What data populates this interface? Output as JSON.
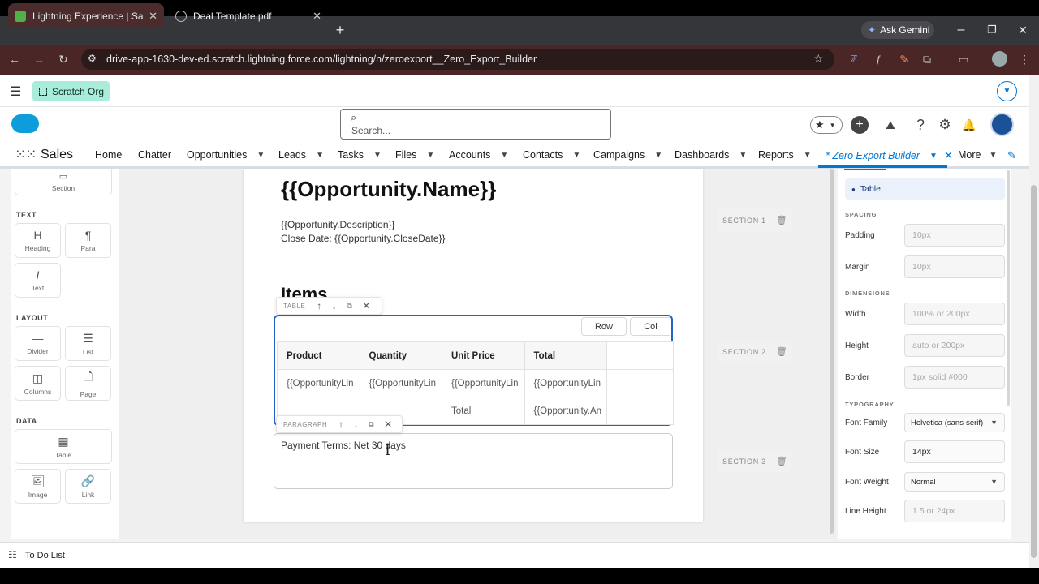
{
  "browser": {
    "tabs": [
      {
        "label": "Lightning Experience | Salesforce"
      },
      {
        "label": "Deal Template.pdf"
      }
    ],
    "new_tab": "+",
    "gemini_label": "Ask Gemini",
    "url": "drive-app-1630-dev-ed.scratch.lightning.force.com/lightning/n/zeroexport__Zero_Export_Builder",
    "window_min": "–",
    "window_restore": "❐",
    "window_close": "✕"
  },
  "sf": {
    "org_label": "Scratch Org",
    "search_placeholder": "Search...",
    "app_name": "Sales",
    "nav": [
      {
        "label": "Home"
      },
      {
        "label": "Chatter"
      },
      {
        "label": "Opportunities"
      },
      {
        "label": "Leads"
      },
      {
        "label": "Tasks"
      },
      {
        "label": "Files"
      },
      {
        "label": "Accounts"
      },
      {
        "label": "Contacts"
      },
      {
        "label": "Campaigns"
      },
      {
        "label": "Dashboards"
      },
      {
        "label": "Reports"
      },
      {
        "label": "* Zero Export Builder"
      },
      {
        "label": "More"
      }
    ]
  },
  "palette": {
    "top_tile": "Section",
    "text_header": "TEXT",
    "text_items": [
      "Heading",
      "Para",
      "Text"
    ],
    "layout_header": "LAYOUT",
    "layout_items": [
      "Divider",
      "List",
      "Columns",
      "Page"
    ],
    "data_header": "DATA",
    "data_items": [
      "Table",
      "Image",
      "Link"
    ]
  },
  "canvas": {
    "title": "{{Opportunity.Name}}",
    "description": "{{Opportunity.Description}}",
    "close_date": "Close Date: {{Opportunity.CloseDate}}",
    "items_heading": "Items",
    "table_toolbar_label": "TABLE",
    "row_button": "Row",
    "col_button": "Col",
    "table_headers": [
      "Product",
      "Quantity",
      "Unit Price",
      "Total"
    ],
    "table_rows": [
      [
        "{{OpportunityLin",
        "{{OpportunityLin",
        "{{OpportunityLin",
        "{{OpportunityLin"
      ],
      [
        "",
        "",
        "Total",
        "{{Opportunity.An"
      ]
    ],
    "paragraph_toolbar_label": "PARAGRAPH",
    "paragraph_text": "Payment Terms: Net 30 days",
    "sections": [
      "SECTION 1",
      "SECTION 2",
      "SECTION 3"
    ]
  },
  "properties": {
    "selected": "Table",
    "spacing_header": "SPACING",
    "padding_label": "Padding",
    "padding_placeholder": "10px",
    "margin_label": "Margin",
    "margin_placeholder": "10px",
    "dimensions_header": "DIMENSIONS",
    "width_label": "Width",
    "width_placeholder": "100% or 200px",
    "height_label": "Height",
    "height_placeholder": "auto or 200px",
    "border_label": "Border",
    "border_placeholder": "1px solid #000",
    "typography_header": "TYPOGRAPHY",
    "font_family_label": "Font Family",
    "font_family_value": "Helvetica (sans-serif)",
    "font_size_label": "Font Size",
    "font_size_value": "14px",
    "font_weight_label": "Font Weight",
    "font_weight_value": "Normal",
    "line_height_label": "Line Height",
    "line_height_placeholder": "1.5 or 24px"
  },
  "footer": {
    "todo_label": "To Do List"
  },
  "colors": {
    "accent": "#0176d3",
    "table_border": "#2563c9",
    "scratch_org": "#a9ecd9"
  }
}
